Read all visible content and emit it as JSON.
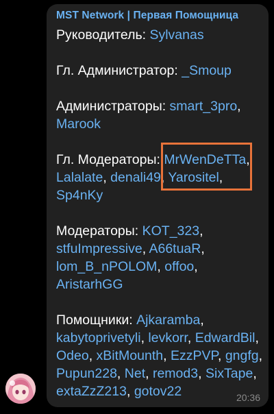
{
  "message": {
    "sender": "MST Network | Первая Помощница",
    "time": "20:36",
    "lead_label": "Руководитель:",
    "lead": "Sylvanas",
    "chief_admin_label": "Гл. Администратор:",
    "chief_admin": "_Smoup",
    "admins_label": "Администраторы:",
    "admins": [
      "smart_3pro",
      "Marook"
    ],
    "chief_mods_label": "Гл. Модераторы:",
    "chief_mods": [
      "MrWenDeTTa",
      "Lalalate",
      "denali49",
      "Yarositel",
      "Sp4nKy"
    ],
    "mods_label": "Модераторы:",
    "mods": [
      "KOT_323",
      "stfuImpressive",
      "A66tuaR",
      "lom_B_nPOLOM",
      "offoo",
      "AristarhGG"
    ],
    "helpers_label": "Помощники:",
    "helpers": [
      "Ajkaramba",
      "kabytoprivetyli",
      "levkorr",
      "EdwardBil",
      "Odeo",
      "xBitMounth",
      "EzzPVP",
      "gngfg",
      "Pupun228",
      "Net",
      "remod3",
      "SixTape",
      "extaZzZ213",
      "gotov22"
    ]
  },
  "colors": {
    "background": "#000000",
    "bubble": "#212121",
    "link": "#6ab2f2",
    "highlight": "#e8733a"
  },
  "icons": {
    "avatar": "anime-girl-avatar"
  }
}
